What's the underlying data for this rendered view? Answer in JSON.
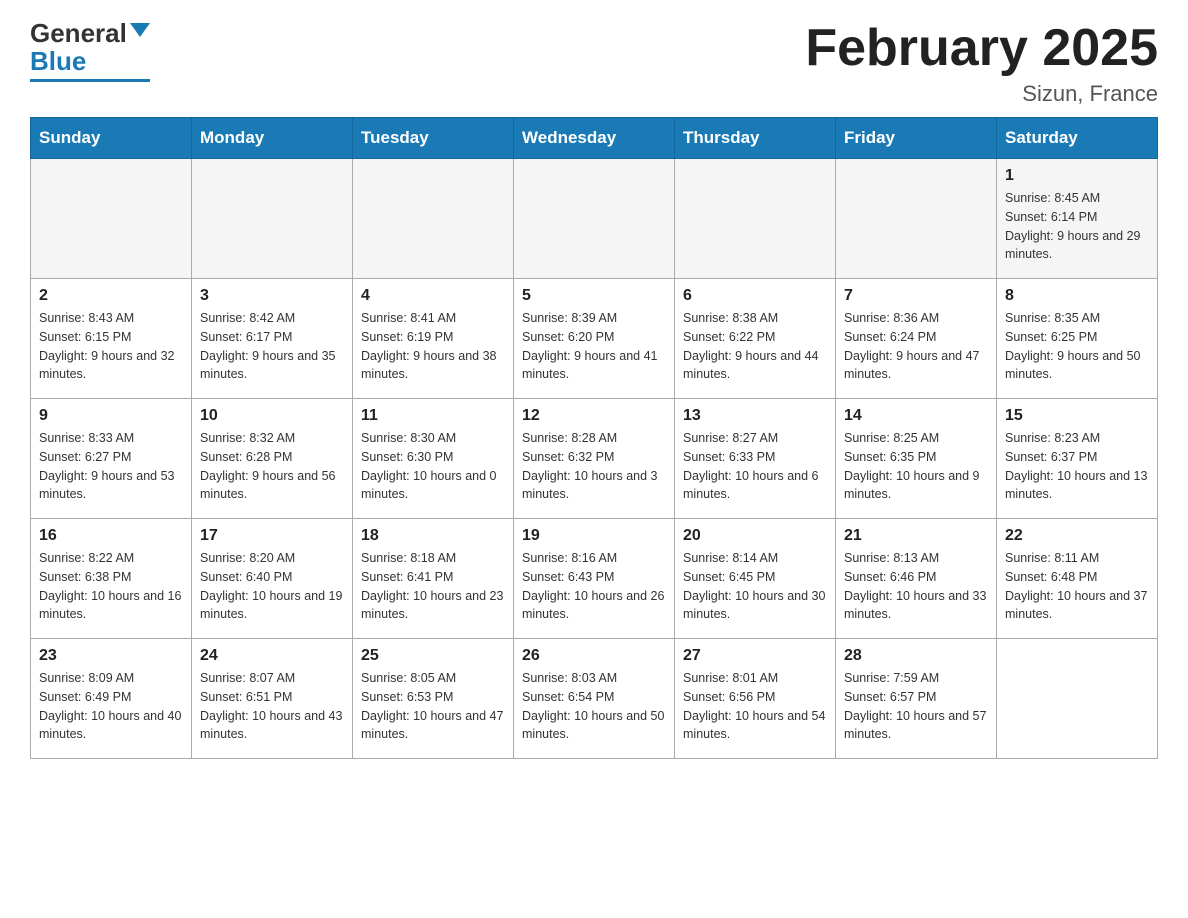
{
  "logo": {
    "general": "General",
    "blue": "Blue"
  },
  "title": "February 2025",
  "location": "Sizun, France",
  "days_of_week": [
    "Sunday",
    "Monday",
    "Tuesday",
    "Wednesday",
    "Thursday",
    "Friday",
    "Saturday"
  ],
  "weeks": [
    [
      {
        "day": "",
        "info": ""
      },
      {
        "day": "",
        "info": ""
      },
      {
        "day": "",
        "info": ""
      },
      {
        "day": "",
        "info": ""
      },
      {
        "day": "",
        "info": ""
      },
      {
        "day": "",
        "info": ""
      },
      {
        "day": "1",
        "info": "Sunrise: 8:45 AM\nSunset: 6:14 PM\nDaylight: 9 hours and 29 minutes."
      }
    ],
    [
      {
        "day": "2",
        "info": "Sunrise: 8:43 AM\nSunset: 6:15 PM\nDaylight: 9 hours and 32 minutes."
      },
      {
        "day": "3",
        "info": "Sunrise: 8:42 AM\nSunset: 6:17 PM\nDaylight: 9 hours and 35 minutes."
      },
      {
        "day": "4",
        "info": "Sunrise: 8:41 AM\nSunset: 6:19 PM\nDaylight: 9 hours and 38 minutes."
      },
      {
        "day": "5",
        "info": "Sunrise: 8:39 AM\nSunset: 6:20 PM\nDaylight: 9 hours and 41 minutes."
      },
      {
        "day": "6",
        "info": "Sunrise: 8:38 AM\nSunset: 6:22 PM\nDaylight: 9 hours and 44 minutes."
      },
      {
        "day": "7",
        "info": "Sunrise: 8:36 AM\nSunset: 6:24 PM\nDaylight: 9 hours and 47 minutes."
      },
      {
        "day": "8",
        "info": "Sunrise: 8:35 AM\nSunset: 6:25 PM\nDaylight: 9 hours and 50 minutes."
      }
    ],
    [
      {
        "day": "9",
        "info": "Sunrise: 8:33 AM\nSunset: 6:27 PM\nDaylight: 9 hours and 53 minutes."
      },
      {
        "day": "10",
        "info": "Sunrise: 8:32 AM\nSunset: 6:28 PM\nDaylight: 9 hours and 56 minutes."
      },
      {
        "day": "11",
        "info": "Sunrise: 8:30 AM\nSunset: 6:30 PM\nDaylight: 10 hours and 0 minutes."
      },
      {
        "day": "12",
        "info": "Sunrise: 8:28 AM\nSunset: 6:32 PM\nDaylight: 10 hours and 3 minutes."
      },
      {
        "day": "13",
        "info": "Sunrise: 8:27 AM\nSunset: 6:33 PM\nDaylight: 10 hours and 6 minutes."
      },
      {
        "day": "14",
        "info": "Sunrise: 8:25 AM\nSunset: 6:35 PM\nDaylight: 10 hours and 9 minutes."
      },
      {
        "day": "15",
        "info": "Sunrise: 8:23 AM\nSunset: 6:37 PM\nDaylight: 10 hours and 13 minutes."
      }
    ],
    [
      {
        "day": "16",
        "info": "Sunrise: 8:22 AM\nSunset: 6:38 PM\nDaylight: 10 hours and 16 minutes."
      },
      {
        "day": "17",
        "info": "Sunrise: 8:20 AM\nSunset: 6:40 PM\nDaylight: 10 hours and 19 minutes."
      },
      {
        "day": "18",
        "info": "Sunrise: 8:18 AM\nSunset: 6:41 PM\nDaylight: 10 hours and 23 minutes."
      },
      {
        "day": "19",
        "info": "Sunrise: 8:16 AM\nSunset: 6:43 PM\nDaylight: 10 hours and 26 minutes."
      },
      {
        "day": "20",
        "info": "Sunrise: 8:14 AM\nSunset: 6:45 PM\nDaylight: 10 hours and 30 minutes."
      },
      {
        "day": "21",
        "info": "Sunrise: 8:13 AM\nSunset: 6:46 PM\nDaylight: 10 hours and 33 minutes."
      },
      {
        "day": "22",
        "info": "Sunrise: 8:11 AM\nSunset: 6:48 PM\nDaylight: 10 hours and 37 minutes."
      }
    ],
    [
      {
        "day": "23",
        "info": "Sunrise: 8:09 AM\nSunset: 6:49 PM\nDaylight: 10 hours and 40 minutes."
      },
      {
        "day": "24",
        "info": "Sunrise: 8:07 AM\nSunset: 6:51 PM\nDaylight: 10 hours and 43 minutes."
      },
      {
        "day": "25",
        "info": "Sunrise: 8:05 AM\nSunset: 6:53 PM\nDaylight: 10 hours and 47 minutes."
      },
      {
        "day": "26",
        "info": "Sunrise: 8:03 AM\nSunset: 6:54 PM\nDaylight: 10 hours and 50 minutes."
      },
      {
        "day": "27",
        "info": "Sunrise: 8:01 AM\nSunset: 6:56 PM\nDaylight: 10 hours and 54 minutes."
      },
      {
        "day": "28",
        "info": "Sunrise: 7:59 AM\nSunset: 6:57 PM\nDaylight: 10 hours and 57 minutes."
      },
      {
        "day": "",
        "info": ""
      }
    ]
  ]
}
